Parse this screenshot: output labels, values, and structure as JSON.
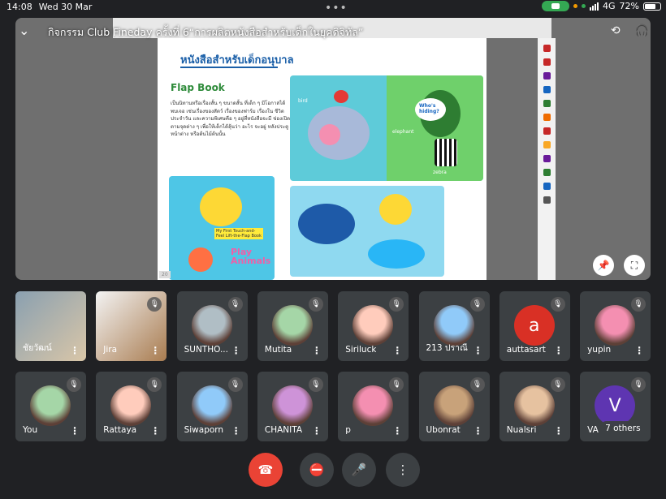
{
  "status": {
    "time": "14:08",
    "date": "Wed 30 Mar",
    "network": "4G",
    "battery": "72%",
    "battery_level": 0.72
  },
  "meeting": {
    "title": "กิจกรรม Club Fineday ครั้งที่ 6“การผลิตหนังสือสำหรับเด็กในยุคดิจิทัล”"
  },
  "presentation": {
    "heading": "หนังสือสำหรับเด็กอนุบาล",
    "section": "Flap Book",
    "body": "เป็นนิทานหรือเรื่องสั้น ๆ ขนาดสั้น ที่เด็ก ๆ มีโอกาสได้พบเจอ เช่นเรื่องของสัตว์ เรื่องของฟาร์ม เรื่องใน ชีวิตประจำวัน และความพิเศษคือ ๆ อยู่ที่หนังสือจะมี ช่องเปิดตามจุดต่าง ๆ เพื่อให้เด็กได้ลุ้นว่า อะไร จะอยู่ หลังประตู หน้าต่าง หรือต้นไม้ต้นนั้น",
    "page_number": "20",
    "book_labels": {
      "bird": "bird",
      "elephant": "elephant",
      "zebra": "zebra",
      "whos_hiding": "Who's hiding?",
      "cover_small": "My First Touch-and-Feel Lift-the-Flap Book",
      "cover_big": "Play Animals"
    }
  },
  "participants_row1": [
    {
      "name": "ชัยวัฒน์",
      "type": "video",
      "muted": false
    },
    {
      "name": "Jira",
      "type": "video",
      "muted": true
    },
    {
      "name": "SUNTHO...",
      "type": "photo",
      "muted": true
    },
    {
      "name": "Mutita",
      "type": "photo",
      "muted": true
    },
    {
      "name": "Siriluck",
      "type": "photo",
      "muted": true
    },
    {
      "name": "213 ปราณี",
      "type": "photo",
      "muted": true
    },
    {
      "name": "auttasart",
      "type": "letter",
      "letter": "a",
      "color": "#d93025",
      "muted": true
    },
    {
      "name": "yupin",
      "type": "photo",
      "muted": true
    }
  ],
  "participants_row2": [
    {
      "name": "You",
      "type": "photo",
      "muted": true
    },
    {
      "name": "Rattaya",
      "type": "photo",
      "muted": true
    },
    {
      "name": "Siwaporn",
      "type": "photo",
      "muted": true
    },
    {
      "name": "CHANITA",
      "type": "photo",
      "muted": true
    },
    {
      "name": "p",
      "type": "photo",
      "muted": true
    },
    {
      "name": "Ubonrat",
      "type": "photo",
      "muted": true
    },
    {
      "name": "Nualsri",
      "type": "photo",
      "muted": true
    },
    {
      "name": "VA",
      "type": "letter",
      "letter": "V",
      "color": "#5e35b1",
      "muted": true,
      "others": "7 others"
    }
  ],
  "icons": {
    "back": "chevron-down-icon",
    "camera_switch": "camera-switch-icon",
    "audio": "headphones-icon",
    "pin": "pin-icon",
    "fullscreen": "fullscreen-icon",
    "end_call": "end-call-icon",
    "camera_off": "camera-off-icon",
    "mic_off": "mic-off-icon",
    "more": "more-vertical-icon"
  },
  "colors": {
    "end_call": "#ea4335",
    "control_bg": "#3c4043",
    "tile_bg": "#3c4043",
    "page_bg": "#202124"
  }
}
